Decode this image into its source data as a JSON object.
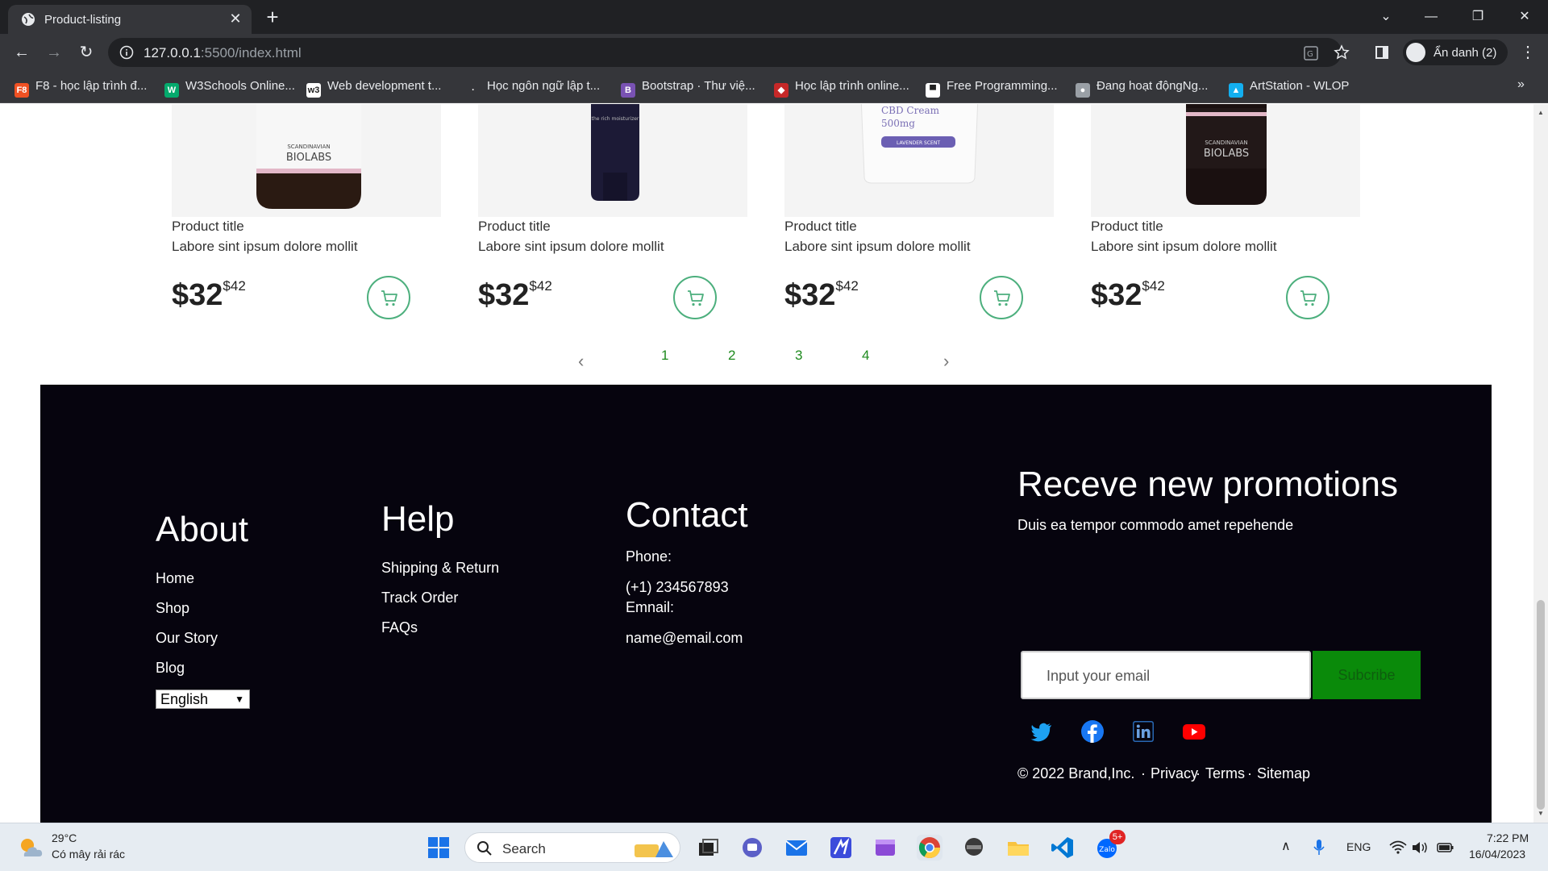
{
  "browser": {
    "tab_title": "Product-listing",
    "url_host": "127.0.0.1",
    "url_rest": ":5500/index.html",
    "profile_label": "Ẩn danh (2)",
    "bookmarks": [
      {
        "label": "F8 - học lập trình đ...",
        "icon": "F8",
        "color": "#f05123"
      },
      {
        "label": "W3Schools Online...",
        "icon": "W",
        "color": "#04aa6d"
      },
      {
        "label": "Web development t...",
        "icon": "w3",
        "color": "#ffffff"
      },
      {
        "label": "Học ngôn ngữ lập t...",
        "icon": "·",
        "color": "#35363a"
      },
      {
        "label": "Bootstrap · Thư việ...",
        "icon": "B",
        "color": "#7952b3"
      },
      {
        "label": "Học lập trình online...",
        "icon": "◆",
        "color": "#c62828"
      },
      {
        "label": "Free Programming...",
        "icon": "▀",
        "color": "#ffffff"
      },
      {
        "label": "Đang hoạt độngNg...",
        "icon": "●",
        "color": "#9aa0a6"
      },
      {
        "label": "ArtStation - WLOP",
        "icon": "▲",
        "color": "#13aff0"
      }
    ]
  },
  "products": [
    {
      "title": "Product title",
      "desc": "Labore sint ipsum dolore mollit",
      "price": "$32",
      "cents": "$42"
    },
    {
      "title": "Product title",
      "desc": "Labore sint ipsum dolore mollit",
      "price": "$32",
      "cents": "$42"
    },
    {
      "title": "Product title",
      "desc": "Labore sint ipsum dolore mollit",
      "price": "$32",
      "cents": "$42"
    },
    {
      "title": "Product title",
      "desc": "Labore sint ipsum dolore mollit",
      "price": "$32",
      "cents": "$42"
    }
  ],
  "product_images": {
    "cream_line1": "CBD Cream",
    "cream_line2": "500mg",
    "cream_badge": "LAVENDER SCENT",
    "brand": "BIOLABS",
    "brand_small": "SCANDINAVIAN"
  },
  "pagination": {
    "pages": [
      "1",
      "2",
      "3",
      "4"
    ],
    "prev": "‹",
    "next": "›"
  },
  "footer": {
    "about": {
      "heading": "About",
      "links": [
        "Home",
        "Shop",
        "Our Story",
        "Blog"
      ],
      "language": "English"
    },
    "help": {
      "heading": "Help",
      "links": [
        "Shipping & Return",
        "Track Order",
        "FAQs"
      ]
    },
    "contact": {
      "heading": "Contact",
      "phone_label": "Phone:",
      "phone": "(+1) 234567893",
      "email_label": "Emnail:",
      "email": "name@email.com"
    },
    "promo": {
      "heading": "Receve new promotions",
      "subtext": "Duis ea tempor commodo amet repehende",
      "email_placeholder": "Input your email",
      "subscribe": "Subcribe",
      "copyright": "© 2022 Brand,Inc.",
      "links": [
        "Privacy",
        "Terms",
        "Sitemap"
      ],
      "social_colors": {
        "twitter": "#1da1f2",
        "facebook": "#1877f2",
        "linkedin": "#2867b2",
        "youtube": "#ff0000"
      }
    }
  },
  "taskbar": {
    "weather_temp": "29°C",
    "weather_desc": "Có mây rải rác",
    "search_label": "Search",
    "lang": "ENG",
    "time": "7:22 PM",
    "date": "16/04/2023",
    "zalo_badge": "5+"
  }
}
